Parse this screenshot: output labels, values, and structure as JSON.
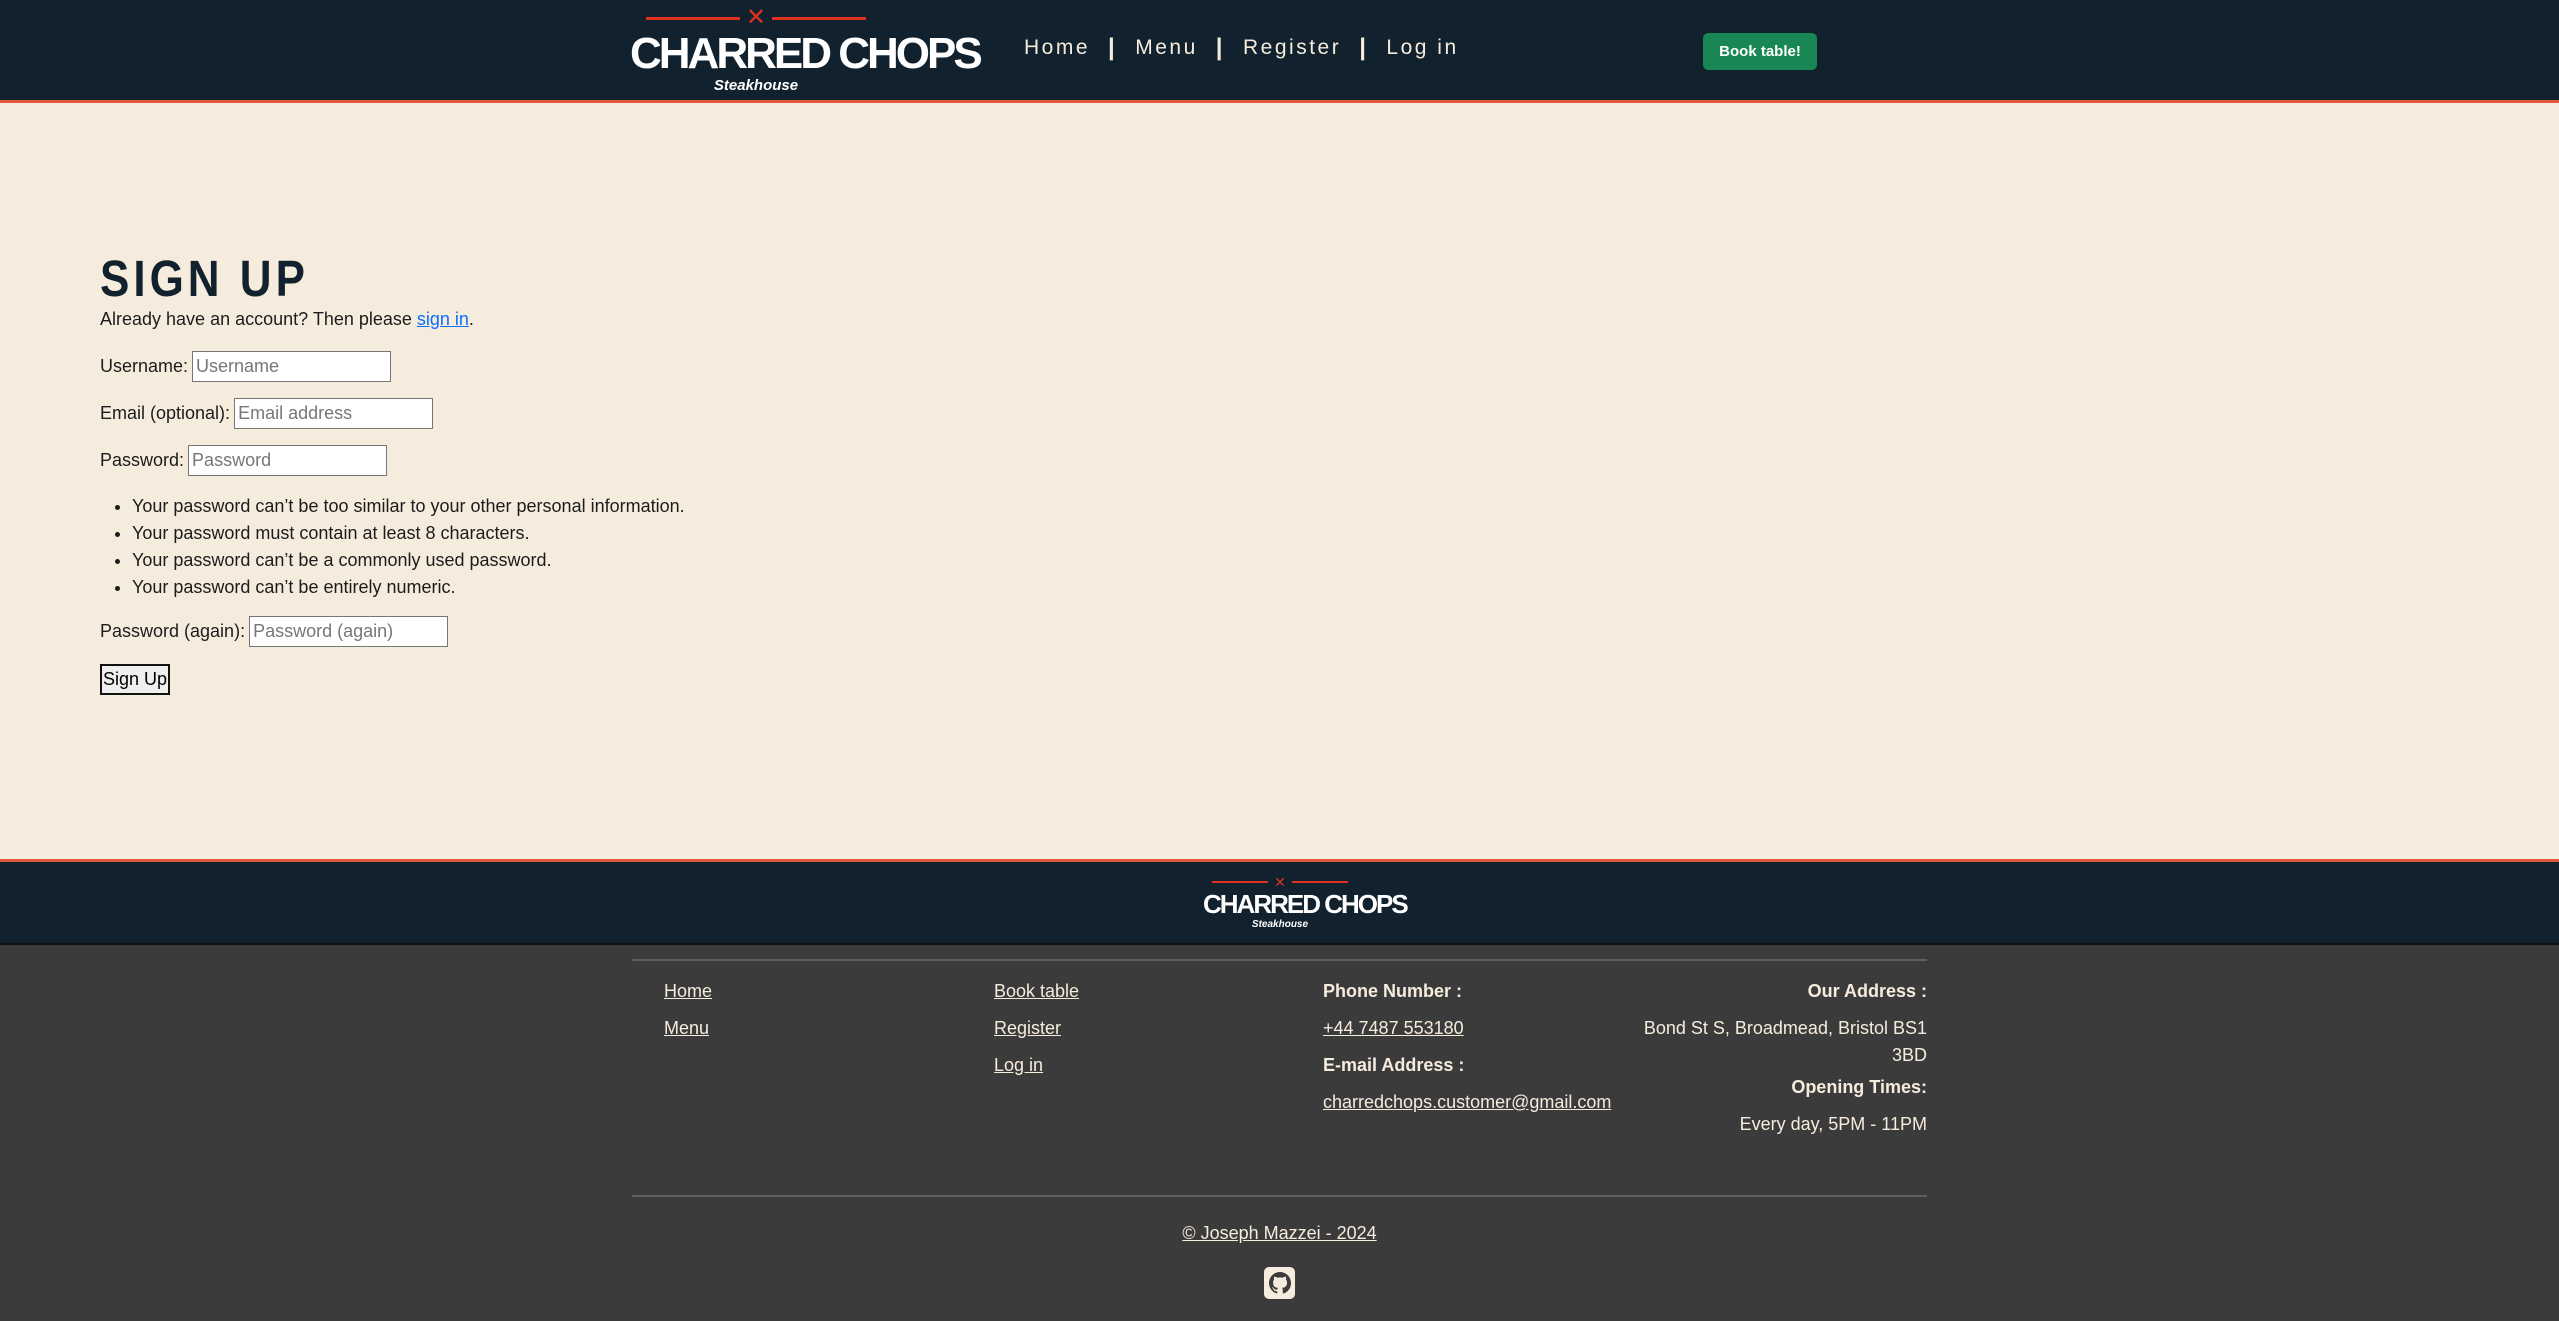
{
  "header": {
    "logo": {
      "name": "CHARRED CHOPS",
      "sub": "Steakhouse"
    },
    "nav": [
      {
        "label": "Home"
      },
      {
        "label": "Menu"
      },
      {
        "label": "Register"
      },
      {
        "label": "Log in"
      }
    ],
    "separator": "|",
    "book_button": "Book table!"
  },
  "main": {
    "title": "SIGN UP",
    "intro_prefix": "Already have an account? Then please ",
    "intro_link": "sign in",
    "intro_suffix": ".",
    "fields": [
      {
        "label": "Username:",
        "placeholder": "Username",
        "value": ""
      },
      {
        "label": "Email (optional):",
        "placeholder": "Email address",
        "value": ""
      },
      {
        "label": "Password:",
        "placeholder": "Password",
        "value": ""
      }
    ],
    "help": [
      "Your password can’t be too similar to your other personal information.",
      "Your password must contain at least 8 characters.",
      "Your password can’t be a commonly used password.",
      "Your password can’t be entirely numeric."
    ],
    "password_again": {
      "label": "Password (again):",
      "placeholder": "Password (again)",
      "value": ""
    },
    "submit": "Sign Up"
  },
  "footer": {
    "logo": {
      "name": "CHARRED CHOPS",
      "sub": "Steakhouse"
    },
    "col1": [
      "Home",
      "Menu"
    ],
    "col2": [
      "Book table",
      "Register",
      "Log in"
    ],
    "phone_label": "Phone Number :",
    "phone": "+44 7487 553180",
    "email_label": "E-mail Address :",
    "email": "charredchops.customer@gmail.com",
    "address_label": "Our Address :",
    "address_line1": "Bond St S, Broadmead, Bristol BS1",
    "address_line2": "3BD",
    "hours_label": "Opening Times:",
    "hours": "Every day, 5PM - 11PM",
    "copyright": "© Joseph Mazzei - 2024",
    "social_icon": "github-icon"
  },
  "colors": {
    "header_bg": "#11212d",
    "accent": "#e0583c",
    "page_bg": "#f6ecdd",
    "footer_bg": "#3b3b3b",
    "book_button": "#198754"
  }
}
